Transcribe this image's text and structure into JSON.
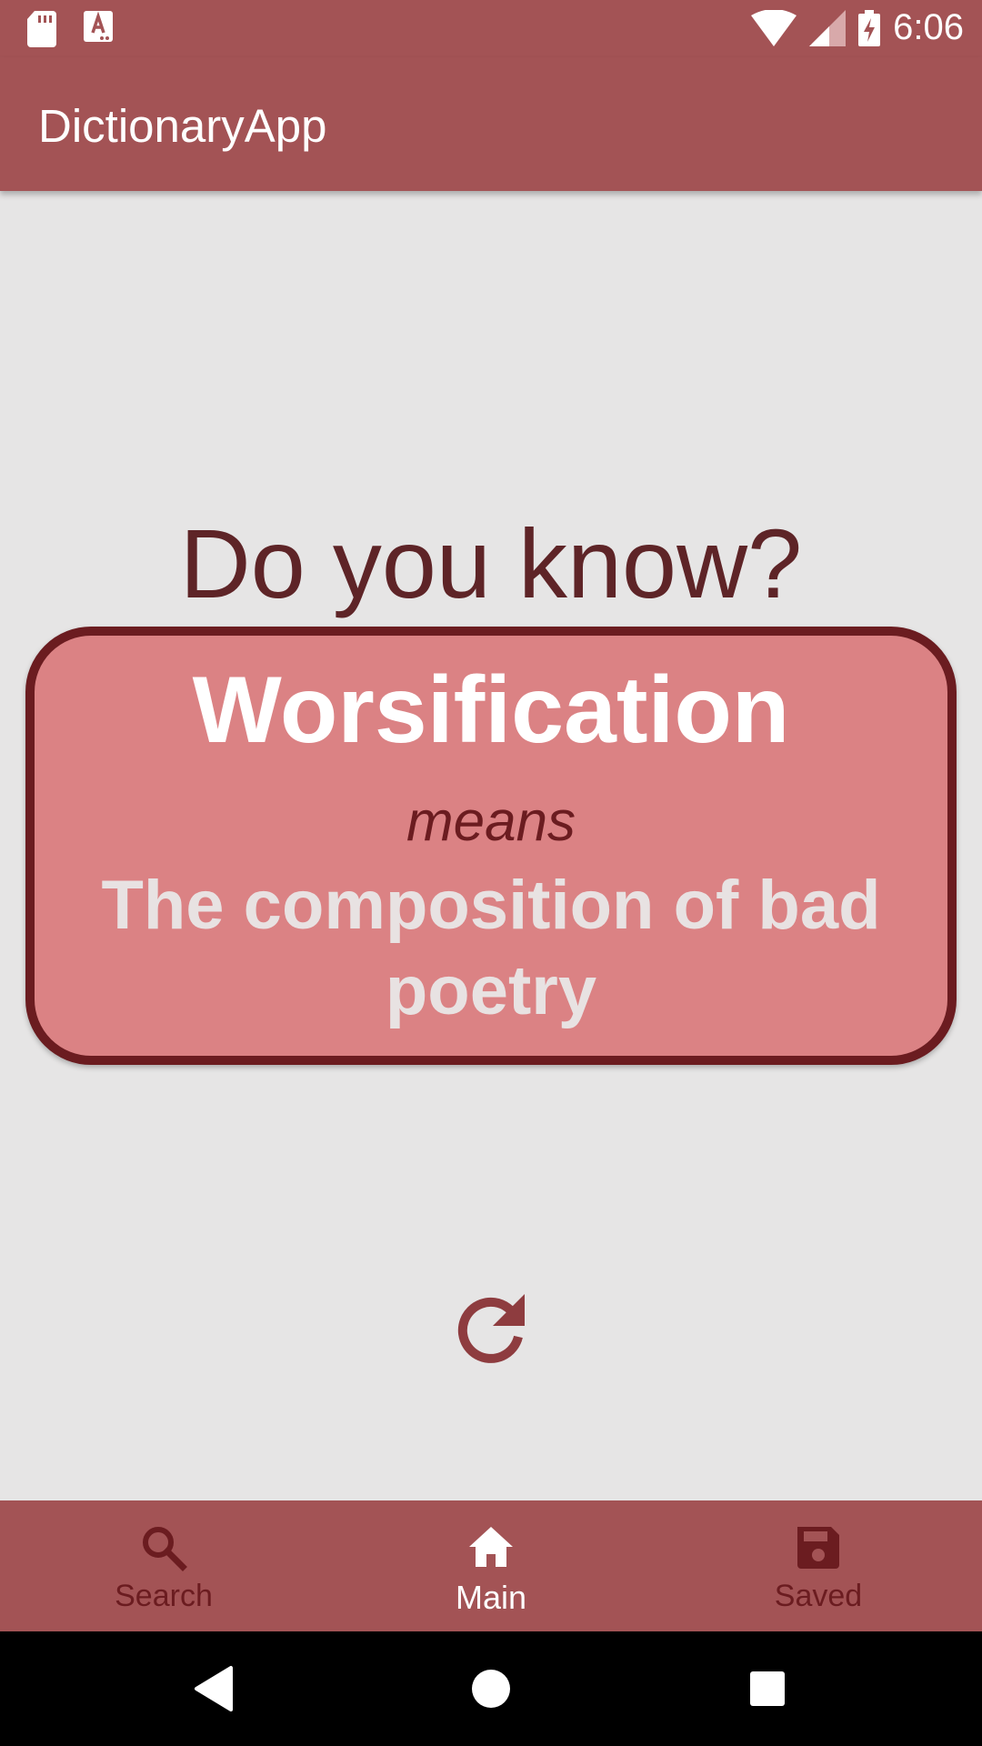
{
  "status_bar": {
    "time": "6:06",
    "icons": [
      "sd-card-icon",
      "text-notification-icon",
      "wifi-icon",
      "signal-icon",
      "battery-charging-icon"
    ]
  },
  "app_bar": {
    "title": "DictionaryApp"
  },
  "main": {
    "prompt": "Do you know?",
    "card": {
      "word": "Worsification",
      "connector": "means",
      "definition": "The composition of bad poetry"
    },
    "refresh_icon": "refresh-icon"
  },
  "bottom_nav": {
    "items": [
      {
        "label": "Search",
        "icon": "search-icon",
        "active": false
      },
      {
        "label": "Main",
        "icon": "home-icon",
        "active": true
      },
      {
        "label": "Saved",
        "icon": "save-icon",
        "active": false
      }
    ]
  },
  "system_nav": {
    "buttons": [
      "back-icon",
      "home-circle-icon",
      "recents-icon"
    ]
  },
  "colors": {
    "primary": "#a35355",
    "dark_accent": "#6b1c20",
    "card_fill": "#db8284",
    "background": "#e6e5e5",
    "prompt_text": "#5e2427"
  }
}
